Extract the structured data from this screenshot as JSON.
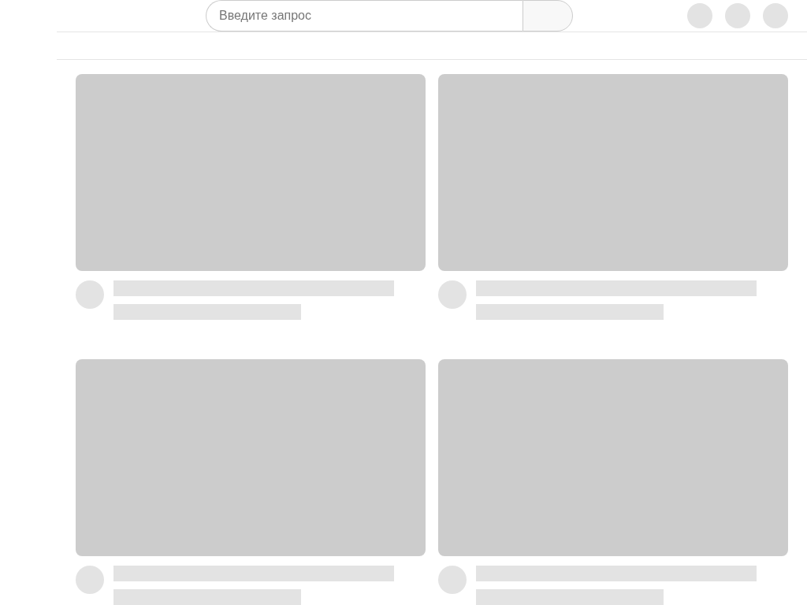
{
  "search": {
    "placeholder": "Введите запрос"
  },
  "header_buttons": [
    {
      "kind": "placeholder"
    },
    {
      "kind": "placeholder"
    },
    {
      "kind": "placeholder"
    }
  ],
  "videos": [
    {
      "kind": "skeleton"
    },
    {
      "kind": "skeleton"
    },
    {
      "kind": "skeleton"
    },
    {
      "kind": "skeleton"
    }
  ]
}
